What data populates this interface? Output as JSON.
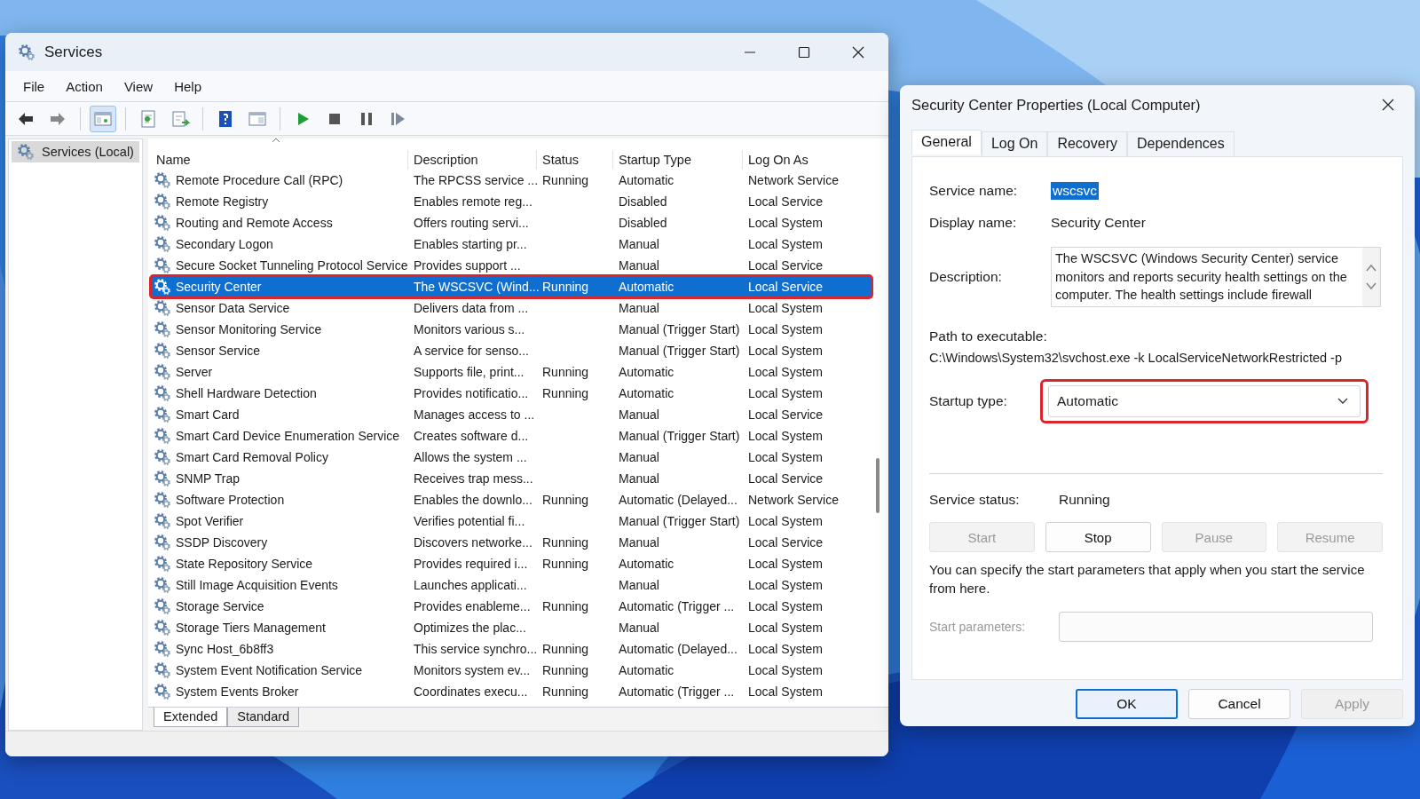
{
  "window": {
    "title": "Services"
  },
  "menu": [
    "File",
    "Action",
    "View",
    "Help"
  ],
  "toolbar": [
    {
      "kind": "back",
      "pressed": false,
      "separator_before": false
    },
    {
      "kind": "forward",
      "pressed": false,
      "separator_before": false
    },
    {
      "kind": "console-tree",
      "pressed": true,
      "separator_before": true
    },
    {
      "kind": "export",
      "pressed": false,
      "separator_before": true
    },
    {
      "kind": "refresh",
      "pressed": false,
      "separator_before": false
    },
    {
      "kind": "help",
      "pressed": false,
      "separator_before": true
    },
    {
      "kind": "show-hide",
      "pressed": false,
      "separator_before": false
    },
    {
      "kind": "start",
      "pressed": false,
      "separator_before": true
    },
    {
      "kind": "stop",
      "pressed": false,
      "separator_before": false
    },
    {
      "kind": "pause",
      "pressed": false,
      "separator_before": false
    },
    {
      "kind": "resume",
      "pressed": false,
      "separator_before": false
    }
  ],
  "tree": [
    {
      "label": "Services (Local)",
      "selected": true
    }
  ],
  "table": {
    "columns": [
      {
        "label": "Name",
        "sorted": true
      },
      {
        "label": "Description",
        "sorted": false
      },
      {
        "label": "Status",
        "sorted": false
      },
      {
        "label": "Startup Type",
        "sorted": false
      },
      {
        "label": "Log On As",
        "sorted": false
      }
    ],
    "rows": [
      {
        "name": "Remote Procedure Call (RPC)",
        "description": "The RPCSS service ...",
        "status": "Running",
        "startup_type": "Automatic",
        "log_on_as": "Network Service",
        "selected": false,
        "outlined": false
      },
      {
        "name": "Remote Registry",
        "description": "Enables remote reg...",
        "startup_type": "Disabled",
        "log_on_as": "Local Service",
        "selected": false,
        "outlined": false
      },
      {
        "name": "Routing and Remote Access",
        "description": "Offers routing servi...",
        "startup_type": "Disabled",
        "log_on_as": "Local System",
        "selected": false,
        "outlined": false
      },
      {
        "name": "Secondary Logon",
        "description": "Enables starting pr...",
        "startup_type": "Manual",
        "log_on_as": "Local System",
        "selected": false,
        "outlined": false
      },
      {
        "name": "Secure Socket Tunneling Protocol Service",
        "description": "Provides support ...",
        "startup_type": "Manual",
        "log_on_as": "Local Service",
        "selected": false,
        "outlined": false
      },
      {
        "name": "Security Center",
        "description": "The WSCSVC (Wind...",
        "status": "Running",
        "startup_type": "Automatic",
        "log_on_as": "Local Service",
        "selected": true,
        "outlined": true
      },
      {
        "name": "Sensor Data Service",
        "description": "Delivers data from ...",
        "startup_type": "Manual",
        "log_on_as": "Local System",
        "selected": false,
        "outlined": false
      },
      {
        "name": "Sensor Monitoring Service",
        "description": "Monitors various s...",
        "startup_type": "Manual (Trigger Start)",
        "log_on_as": "Local System",
        "selected": false,
        "outlined": false
      },
      {
        "name": "Sensor Service",
        "description": "A service for senso...",
        "startup_type": "Manual (Trigger Start)",
        "log_on_as": "Local System",
        "selected": false,
        "outlined": false
      },
      {
        "name": "Server",
        "description": "Supports file, print...",
        "status": "Running",
        "startup_type": "Automatic",
        "log_on_as": "Local System",
        "selected": false,
        "outlined": false
      },
      {
        "name": "Shell Hardware Detection",
        "description": "Provides notificatio...",
        "status": "Running",
        "startup_type": "Automatic",
        "log_on_as": "Local System",
        "selected": false,
        "outlined": false
      },
      {
        "name": "Smart Card",
        "description": "Manages access to ...",
        "startup_type": "Manual",
        "log_on_as": "Local Service",
        "selected": false,
        "outlined": false
      },
      {
        "name": "Smart Card Device Enumeration Service",
        "description": "Creates software d...",
        "startup_type": "Manual (Trigger Start)",
        "log_on_as": "Local System",
        "selected": false,
        "outlined": false
      },
      {
        "name": "Smart Card Removal Policy",
        "description": "Allows the system ...",
        "startup_type": "Manual",
        "log_on_as": "Local System",
        "selected": false,
        "outlined": false
      },
      {
        "name": "SNMP Trap",
        "description": "Receives trap mess...",
        "startup_type": "Manual",
        "log_on_as": "Local Service",
        "selected": false,
        "outlined": false
      },
      {
        "name": "Software Protection",
        "description": "Enables the downlo...",
        "status": "Running",
        "startup_type": "Automatic (Delayed...",
        "log_on_as": "Network Service",
        "selected": false,
        "outlined": false
      },
      {
        "name": "Spot Verifier",
        "description": "Verifies potential fi...",
        "startup_type": "Manual (Trigger Start)",
        "log_on_as": "Local System",
        "selected": false,
        "outlined": false
      },
      {
        "name": "SSDP Discovery",
        "description": "Discovers networke...",
        "status": "Running",
        "startup_type": "Manual",
        "log_on_as": "Local Service",
        "selected": false,
        "outlined": false
      },
      {
        "name": "State Repository Service",
        "description": "Provides required i...",
        "status": "Running",
        "startup_type": "Automatic",
        "log_on_as": "Local System",
        "selected": false,
        "outlined": false
      },
      {
        "name": "Still Image Acquisition Events",
        "description": "Launches applicati...",
        "startup_type": "Manual",
        "log_on_as": "Local System",
        "selected": false,
        "outlined": false
      },
      {
        "name": "Storage Service",
        "description": "Provides enableme...",
        "status": "Running",
        "startup_type": "Automatic (Trigger ...",
        "log_on_as": "Local System",
        "selected": false,
        "outlined": false
      },
      {
        "name": "Storage Tiers Management",
        "description": "Optimizes the plac...",
        "startup_type": "Manual",
        "log_on_as": "Local System",
        "selected": false,
        "outlined": false
      },
      {
        "name": "Sync Host_6b8ff3",
        "description": "This service synchro...",
        "status": "Running",
        "startup_type": "Automatic (Delayed...",
        "log_on_as": "Local System",
        "selected": false,
        "outlined": false
      },
      {
        "name": "System Event Notification Service",
        "description": "Monitors system ev...",
        "status": "Running",
        "startup_type": "Automatic",
        "log_on_as": "Local System",
        "selected": false,
        "outlined": false
      },
      {
        "name": "System Events Broker",
        "description": "Coordinates execu...",
        "status": "Running",
        "startup_type": "Automatic (Trigger ...",
        "log_on_as": "Local System",
        "selected": false,
        "outlined": false
      }
    ]
  },
  "view_tabs": [
    {
      "label": "Extended",
      "selected": true
    },
    {
      "label": "Standard",
      "selected": false
    }
  ],
  "dialog": {
    "title": "Security Center Properties (Local Computer)",
    "tabs": [
      {
        "label": "General",
        "selected": true
      },
      {
        "label": "Log On",
        "selected": false
      },
      {
        "label": "Recovery",
        "selected": false
      },
      {
        "label": "Dependences",
        "selected": false
      }
    ],
    "service_name": {
      "label": "Service name:",
      "value": "wscsvc",
      "highlighted": true
    },
    "display_name": {
      "label": "Display name:",
      "value": "Security Center"
    },
    "description": {
      "label": "Description:",
      "value": "The WSCSVC (Windows Security Center) service monitors and reports security health settings on the computer. The health settings include firewall"
    },
    "path": {
      "label": "Path to executable:",
      "value": "C:\\Windows\\System32\\svchost.exe -k LocalServiceNetworkRestricted -p"
    },
    "startup_type": {
      "label": "Startup type:",
      "value": "Automatic",
      "outlined": true
    },
    "service_status": {
      "label": "Service status:",
      "value": "Running"
    },
    "service_buttons": [
      {
        "label": "Start",
        "disabled": true
      },
      {
        "label": "Stop",
        "disabled": false
      },
      {
        "label": "Pause",
        "disabled": true
      },
      {
        "label": "Resume",
        "disabled": true
      }
    ],
    "hint": "You can specify the start parameters that apply when you start the service from here.",
    "start_parameters": {
      "label": "Start parameters:",
      "disabled": true
    },
    "buttons": [
      {
        "label": "OK",
        "default": true,
        "disabled": false
      },
      {
        "label": "Cancel",
        "default": false,
        "disabled": false
      },
      {
        "label": "Apply",
        "default": false,
        "disabled": true
      }
    ]
  }
}
